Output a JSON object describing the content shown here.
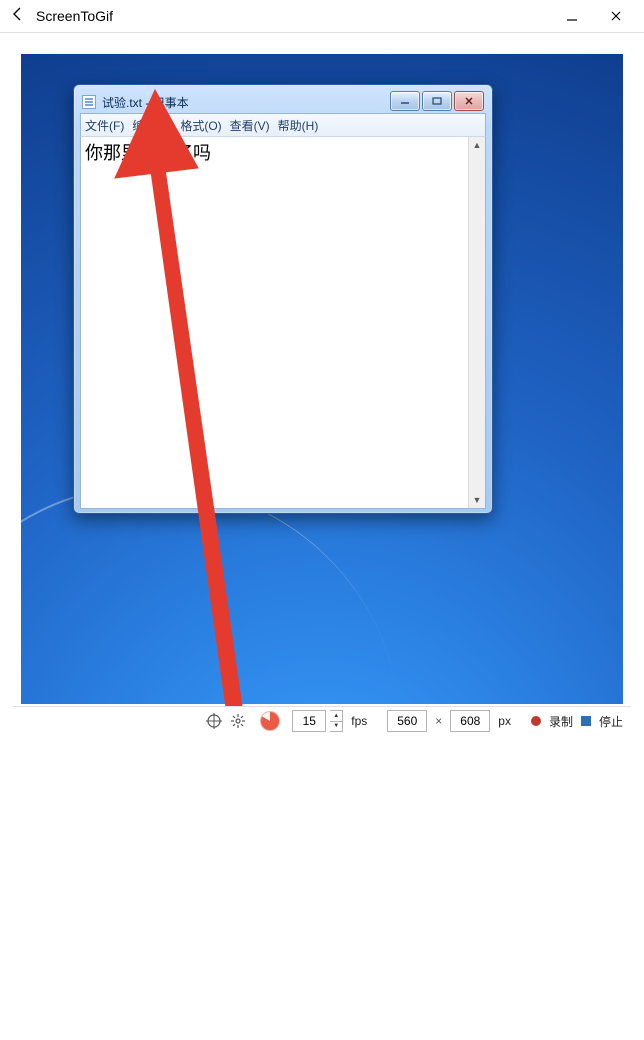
{
  "app": {
    "title": "ScreenToGif"
  },
  "notepad": {
    "title": "试验.txt - 记事本",
    "menu": {
      "file": "文件(F)",
      "edit": "编辑(E)",
      "format": "格式(O)",
      "view": "查看(V)",
      "help": "帮助(H)"
    },
    "content": "你那里下雪了吗"
  },
  "toolbar": {
    "fps_value": "15",
    "fps_label": "fps",
    "width": "560",
    "times": "×",
    "height": "608",
    "px_label": "px",
    "record_label": "录制",
    "stop_label": "停止"
  },
  "annotation": {
    "arrow_color": "#e53b2e"
  }
}
